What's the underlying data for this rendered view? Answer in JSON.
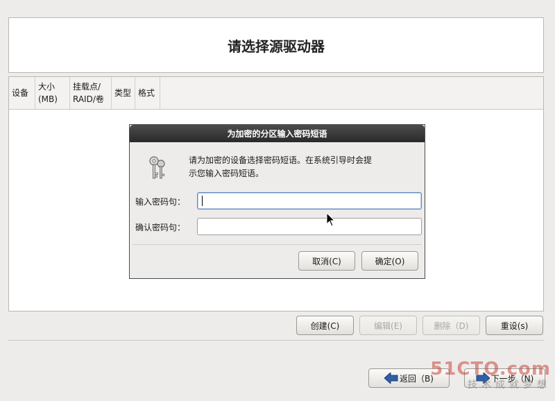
{
  "header": {
    "title": "请选择源驱动器"
  },
  "table": {
    "columns": [
      {
        "line1": "设备",
        "line2": ""
      },
      {
        "line1": "大小",
        "line2": "(MB)"
      },
      {
        "line1": "挂载点/",
        "line2": "RAID/卷"
      },
      {
        "line1": "类型",
        "line2": ""
      },
      {
        "line1": "格式",
        "line2": ""
      }
    ]
  },
  "actions": {
    "create": "创建(C)",
    "edit": "编辑(E)",
    "delete": "删除（D)",
    "reset": "重设(s)"
  },
  "dialog": {
    "title": "为加密的分区输入密码短语",
    "message_line1": "请为加密的设备选择密码短语。在系统引导时会提",
    "message_line2": "示您输入密码短语。",
    "passphrase_label": "输入密码句：",
    "confirm_label": "确认密码句：",
    "passphrase_value": "",
    "confirm_value": "",
    "cancel": "取消(C)",
    "ok": "确定(O)"
  },
  "nav": {
    "back": "返回（B)",
    "next": "下一步（N)"
  },
  "watermark": {
    "main": "51CTO.com",
    "sub": "技术成就梦想"
  }
}
